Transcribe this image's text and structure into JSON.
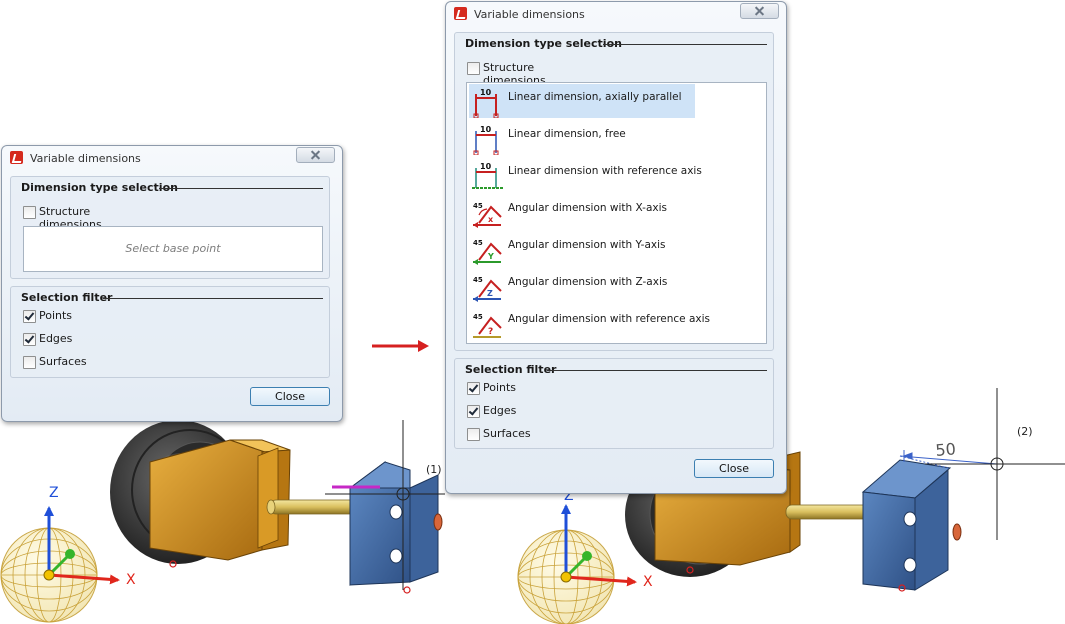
{
  "dialog_small": {
    "title": "Variable dimensions",
    "dimension_type_section": "Dimension type selection",
    "structure_dimensions": {
      "label": "Structure dimensions",
      "checked": false
    },
    "base_point_prompt": "Select base point",
    "selection_filter_section": "Selection filter",
    "filters": [
      {
        "label": "Points",
        "checked": true
      },
      {
        "label": "Edges",
        "checked": true
      },
      {
        "label": "Surfaces",
        "checked": false
      }
    ],
    "close_label": "Close"
  },
  "dialog_large": {
    "title": "Variable dimensions",
    "dimension_type_section": "Dimension type selection",
    "structure_dimensions": {
      "label": "Structure dimensions",
      "checked": false
    },
    "dimension_types": [
      {
        "label": "Linear dimension, axially parallel",
        "icon": "linear-axially-parallel-icon",
        "selected": true
      },
      {
        "label": "Linear dimension, free",
        "icon": "linear-free-icon",
        "selected": false
      },
      {
        "label": "Linear dimension with reference axis",
        "icon": "linear-reference-axis-icon",
        "selected": false
      },
      {
        "label": "Angular dimension with X-axis",
        "icon": "angular-x-axis-icon",
        "selected": false
      },
      {
        "label": "Angular dimension with Y-axis",
        "icon": "angular-y-axis-icon",
        "selected": false
      },
      {
        "label": "Angular dimension with Z-axis",
        "icon": "angular-z-axis-icon",
        "selected": false
      },
      {
        "label": "Angular dimension with reference axis",
        "icon": "angular-reference-axis-icon",
        "selected": false
      }
    ],
    "icon_numbers": {
      "linear": "10",
      "angular": "45"
    },
    "axis_letters": {
      "x": "x",
      "y": "Y",
      "z": "Z",
      "ref": "?"
    },
    "selection_filter_section": "Selection filter",
    "filters": [
      {
        "label": "Points",
        "checked": true
      },
      {
        "label": "Edges",
        "checked": true
      },
      {
        "label": "Surfaces",
        "checked": false
      }
    ],
    "close_label": "Close"
  },
  "scene": {
    "callout_1": "(1)",
    "callout_2": "(2)",
    "dimension_value": "50",
    "axis_labels": {
      "x": "X",
      "z": "Z"
    },
    "colors": {
      "part_orange": "#c8891a",
      "bracket_blue": "#3f6aa1",
      "axis_x": "#e0261c",
      "axis_y": "#35b52b",
      "axis_z": "#1f4fd8",
      "arrow_red": "#d62020",
      "selection_blue": "#3b62c9",
      "highlight_magenta": "#c628c6"
    }
  }
}
